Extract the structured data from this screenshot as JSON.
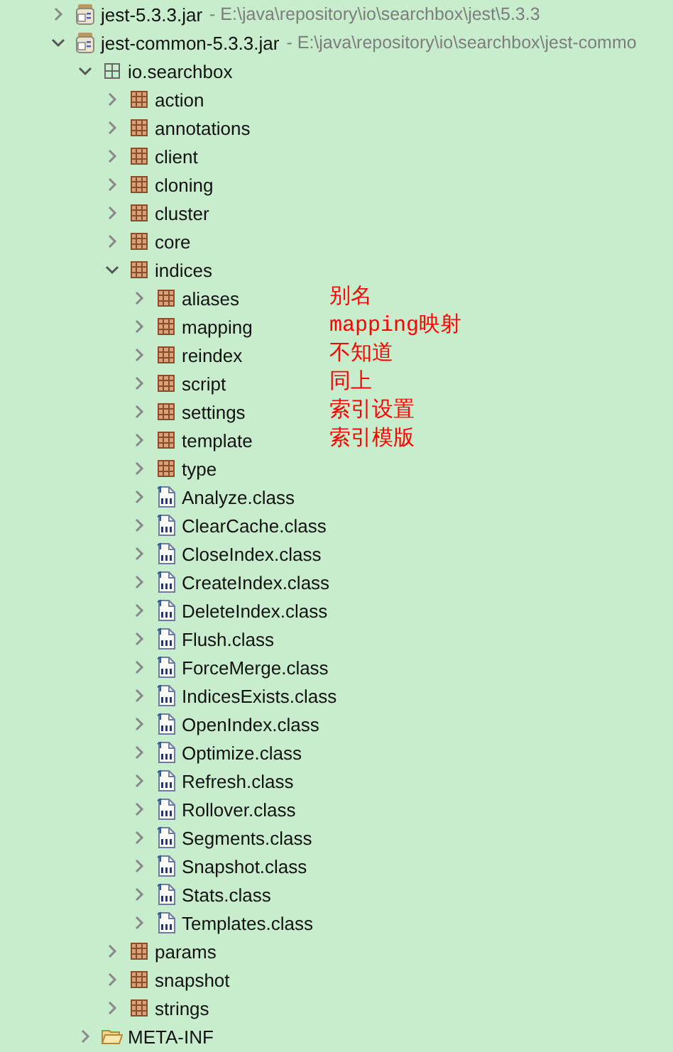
{
  "tree": [
    {
      "kind": "jar",
      "label": "jest-5.3.3.jar",
      "location": "- E:\\java\\repository\\io\\searchbox\\jest\\5.3.3",
      "expanded": false
    },
    {
      "kind": "jar",
      "label": "jest-common-5.3.3.jar",
      "location": "- E:\\java\\repository\\io\\searchbox\\jest-commo",
      "expanded": true,
      "children": [
        {
          "kind": "root-package",
          "label": "io.searchbox",
          "expanded": true,
          "children": [
            {
              "kind": "package",
              "label": "action",
              "expanded": false
            },
            {
              "kind": "package",
              "label": "annotations",
              "expanded": false
            },
            {
              "kind": "package",
              "label": "client",
              "expanded": false
            },
            {
              "kind": "package",
              "label": "cloning",
              "expanded": false
            },
            {
              "kind": "package",
              "label": "cluster",
              "expanded": false
            },
            {
              "kind": "package",
              "label": "core",
              "expanded": false
            },
            {
              "kind": "package",
              "label": "indices",
              "expanded": true,
              "children": [
                {
                  "kind": "package",
                  "label": "aliases",
                  "expanded": false,
                  "annotation": "别名"
                },
                {
                  "kind": "package",
                  "label": "mapping",
                  "expanded": false,
                  "annotation": "mapping映射"
                },
                {
                  "kind": "package",
                  "label": "reindex",
                  "expanded": false,
                  "annotation": "不知道"
                },
                {
                  "kind": "package",
                  "label": "script",
                  "expanded": false,
                  "annotation": "同上"
                },
                {
                  "kind": "package",
                  "label": "settings",
                  "expanded": false,
                  "annotation": "索引设置"
                },
                {
                  "kind": "package",
                  "label": "template",
                  "expanded": false,
                  "annotation": "索引模版"
                },
                {
                  "kind": "package",
                  "label": "type",
                  "expanded": false
                },
                {
                  "kind": "class",
                  "label": "Analyze.class",
                  "expanded": false
                },
                {
                  "kind": "class",
                  "label": "ClearCache.class",
                  "expanded": false
                },
                {
                  "kind": "class",
                  "label": "CloseIndex.class",
                  "expanded": false
                },
                {
                  "kind": "class",
                  "label": "CreateIndex.class",
                  "expanded": false
                },
                {
                  "kind": "class",
                  "label": "DeleteIndex.class",
                  "expanded": false
                },
                {
                  "kind": "class",
                  "label": "Flush.class",
                  "expanded": false
                },
                {
                  "kind": "class",
                  "label": "ForceMerge.class",
                  "expanded": false
                },
                {
                  "kind": "class",
                  "label": "IndicesExists.class",
                  "expanded": false
                },
                {
                  "kind": "class",
                  "label": "OpenIndex.class",
                  "expanded": false
                },
                {
                  "kind": "class",
                  "label": "Optimize.class",
                  "expanded": false
                },
                {
                  "kind": "class",
                  "label": "Refresh.class",
                  "expanded": false
                },
                {
                  "kind": "class",
                  "label": "Rollover.class",
                  "expanded": false
                },
                {
                  "kind": "class",
                  "label": "Segments.class",
                  "expanded": false
                },
                {
                  "kind": "class",
                  "label": "Snapshot.class",
                  "expanded": false
                },
                {
                  "kind": "class",
                  "label": "Stats.class",
                  "expanded": false
                },
                {
                  "kind": "class",
                  "label": "Templates.class",
                  "expanded": false
                }
              ]
            },
            {
              "kind": "package",
              "label": "params",
              "expanded": false
            },
            {
              "kind": "package",
              "label": "snapshot",
              "expanded": false
            },
            {
              "kind": "package",
              "label": "strings",
              "expanded": false
            }
          ]
        },
        {
          "kind": "folder",
          "label": "META-INF",
          "expanded": false
        }
      ]
    }
  ]
}
